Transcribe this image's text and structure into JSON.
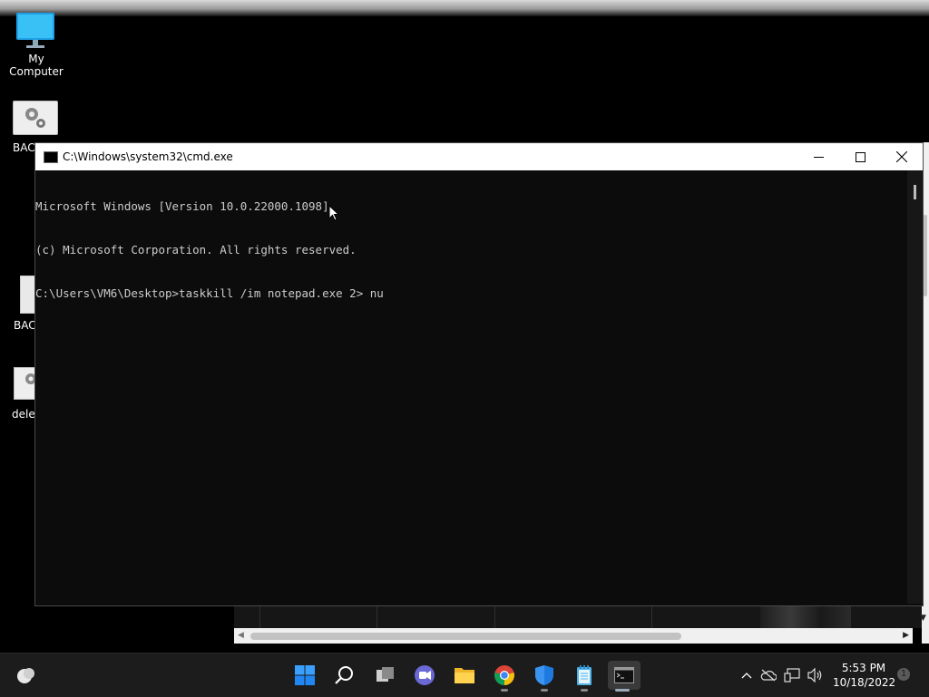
{
  "desktop": {
    "icons": [
      {
        "label": "My Computer"
      },
      {
        "label": "BAC"
      },
      {
        "label": "BAC"
      },
      {
        "label": "delet"
      }
    ]
  },
  "cmd_window": {
    "title": "C:\\Windows\\system32\\cmd.exe",
    "lines": [
      "Microsoft Windows [Version 10.0.22000.1098]",
      "(c) Microsoft Corporation. All rights reserved.",
      "C:\\Users\\VM6\\Desktop>taskkill /im notepad.exe 2> nu"
    ],
    "controls": {
      "minimize": "minimize-icon",
      "maximize": "maximize-icon",
      "close": "close-icon"
    }
  },
  "taskbar": {
    "items": [
      "widgets-icon",
      "start-icon",
      "search-icon",
      "task-view-icon",
      "teams-chat-icon",
      "file-explorer-icon",
      "chrome-icon",
      "defender-icon",
      "notepad-icon",
      "cmd-icon"
    ],
    "tray": [
      "chevron-up-icon",
      "onedrive-icon",
      "network-icon",
      "volume-icon"
    ],
    "clock": {
      "time": "5:53 PM",
      "date": "10/18/2022"
    },
    "notification_count": "1"
  },
  "colors": {
    "console_bg": "#0c0c0c",
    "console_text": "#cccccc",
    "taskbar_bg": "#1c1c1c"
  }
}
